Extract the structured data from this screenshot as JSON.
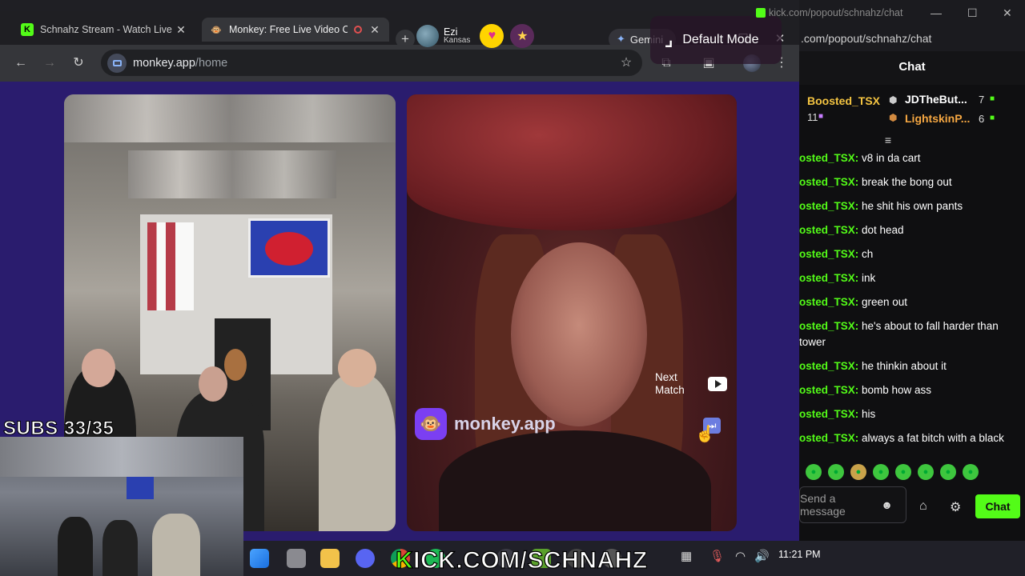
{
  "browser": {
    "tabs": [
      {
        "label": "Schnahz Stream - Watch Live o",
        "favicon": "kick-logo"
      },
      {
        "label": "Monkey: Free Live Video Ch",
        "favicon": "monkey-logo",
        "recording": true
      }
    ],
    "gemini_label": "Gemini",
    "url_host": "monkey.app",
    "url_path": "/home"
  },
  "page": {
    "peer": {
      "name": "Ezi",
      "location": "Kansas",
      "badges": [
        "heart-badge",
        "police-badge"
      ]
    },
    "default_mode_label": "Default Mode",
    "next_match_label": "Next Match",
    "brand_name": "monkey.app"
  },
  "chat": {
    "titlebar_url": "kick.com/popout/schnahz/chat",
    "url": ".com/popout/schnahz/chat",
    "header": "Chat",
    "leaders": [
      {
        "name": "Boosted_TSX",
        "count": "11"
      },
      {
        "name": "JDTheBut...",
        "count": "7"
      },
      {
        "name": "LightskinP...",
        "count": "6"
      }
    ],
    "messages": [
      {
        "user": "osted_TSX:",
        "text": " v8 in da cart"
      },
      {
        "user": "osted_TSX:",
        "text": " break the bong out"
      },
      {
        "user": "osted_TSX:",
        "text": " he shit his own pants"
      },
      {
        "user": "osted_TSX:",
        "text": " dot head"
      },
      {
        "user": "osted_TSX:",
        "text": " ch"
      },
      {
        "user": "osted_TSX:",
        "text": " ink"
      },
      {
        "user": "osted_TSX:",
        "text": " green out"
      },
      {
        "user": "osted_TSX:",
        "text": " he's about to fall harder than tower"
      },
      {
        "user": "osted_TSX:",
        "text": " he thinkin about it"
      },
      {
        "user": "osted_TSX:",
        "text": " bomb how ass"
      },
      {
        "user": "osted_TSX:",
        "text": " his"
      },
      {
        "user": "osted_TSX:",
        "text": " always a fat bitch with a black"
      }
    ],
    "input_placeholder": "Send a message",
    "send_label": "Chat"
  },
  "taskbar": {
    "time": "11:21 PM"
  },
  "overlay": {
    "subs": "SUBS 33/35",
    "link_k": "K",
    "link_rest": "ICK.COM/SCHNAHZ"
  },
  "colors": {
    "kick_green": "#53fc18",
    "monkey_purple": "#2a1c6e"
  }
}
